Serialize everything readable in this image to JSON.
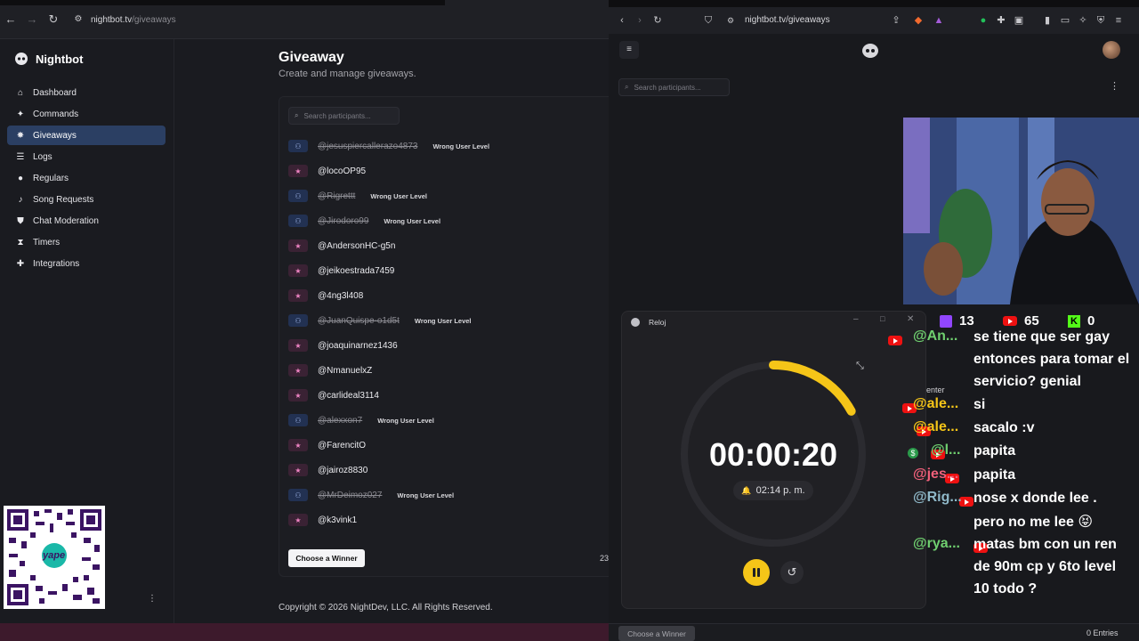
{
  "left_browser": {
    "url_host": "nightbot.tv",
    "url_path": "/giveaways"
  },
  "sidebar": {
    "brand": "Nightbot",
    "items": [
      {
        "label": "Dashboard",
        "icon": "home-icon"
      },
      {
        "label": "Commands",
        "icon": "wand-icon"
      },
      {
        "label": "Giveaways",
        "icon": "gift-icon"
      },
      {
        "label": "Logs",
        "icon": "list-icon"
      },
      {
        "label": "Regulars",
        "icon": "users-icon"
      },
      {
        "label": "Song Requests",
        "icon": "music-icon"
      },
      {
        "label": "Chat Moderation",
        "icon": "shield-icon"
      },
      {
        "label": "Timers",
        "icon": "hourglass-icon"
      },
      {
        "label": "Integrations",
        "icon": "puzzle-icon"
      }
    ]
  },
  "giveaway": {
    "title": "Giveaway",
    "subtitle": "Create and manage giveaways.",
    "search_placeholder": "Search participants...",
    "choose_winner": "Choose a Winner",
    "count": "23",
    "participants": [
      {
        "name": "@jesuspiercallerazo4873",
        "type": "sub",
        "struck": true,
        "tag": "Wrong User Level"
      },
      {
        "name": "@locoOP95",
        "type": "star",
        "struck": false,
        "tag": ""
      },
      {
        "name": "@Rigrettt",
        "type": "sub",
        "struck": true,
        "tag": "Wrong User Level"
      },
      {
        "name": "@Jirodoro99",
        "type": "sub",
        "struck": true,
        "tag": "Wrong User Level"
      },
      {
        "name": "@AndersonHC-g5n",
        "type": "star",
        "struck": false,
        "tag": ""
      },
      {
        "name": "@jeikoestrada7459",
        "type": "star",
        "struck": false,
        "tag": ""
      },
      {
        "name": "@4ng3l408",
        "type": "star",
        "struck": false,
        "tag": ""
      },
      {
        "name": "@JuanQuispe-o1d5t",
        "type": "sub",
        "struck": true,
        "tag": "Wrong User Level"
      },
      {
        "name": "@joaquinarnez1436",
        "type": "star",
        "struck": false,
        "tag": ""
      },
      {
        "name": "@NmanuelxZ",
        "type": "star",
        "struck": false,
        "tag": ""
      },
      {
        "name": "@carlideal3114",
        "type": "star",
        "struck": false,
        "tag": ""
      },
      {
        "name": "@alexxon7",
        "type": "sub",
        "struck": true,
        "tag": "Wrong User Level"
      },
      {
        "name": "@FarencitO",
        "type": "star",
        "struck": false,
        "tag": ""
      },
      {
        "name": "@jairoz8830",
        "type": "star",
        "struck": false,
        "tag": ""
      },
      {
        "name": "@MrDeimoz027",
        "type": "sub",
        "struck": true,
        "tag": "Wrong User Level"
      },
      {
        "name": "@k3vink1",
        "type": "star",
        "struck": false,
        "tag": ""
      }
    ],
    "footer": "Copyright © 2026 NightDev, LLC. All Rights Reserved."
  },
  "right_browser": {
    "url": "nightbot.tv/giveaways",
    "search_placeholder": "Search participants...",
    "choose_winner": "Choose a Winner",
    "entries": "0 Entries"
  },
  "stream_stats": {
    "twitch": "13",
    "youtube": "65",
    "kick": "0"
  },
  "clock": {
    "app_title": "Reloj",
    "time": "00:00:20",
    "alarm": "02:14 p. m.",
    "progress": 0.17,
    "accent": "#f5c518"
  },
  "chat": {
    "fragment": "enter",
    "users": [
      {
        "name": "@An...",
        "color": "#6fcf6f"
      },
      {
        "name": "@ale...",
        "color": "#f5c518"
      },
      {
        "name": "@ale...",
        "color": "#f5c518"
      },
      {
        "name": "@l...",
        "color": "#6fcf6f"
      },
      {
        "name": "@jes...",
        "color": "#f0607a"
      },
      {
        "name": "@Rig...",
        "color": "#8fb8c8"
      },
      {
        "name": "@rya...",
        "color": "#6fcf6f"
      }
    ],
    "messages": [
      "se tiene que ser gay",
      "entonces para tomar el",
      "servicio? genial",
      "si",
      "sacalo :v",
      "papita",
      "papita",
      "nose x donde lee .",
      "pero no me lee 😝",
      "matas bm con un ren",
      "de 90m cp y 6to level",
      "10 todo ?"
    ]
  },
  "qr_label": "yape"
}
